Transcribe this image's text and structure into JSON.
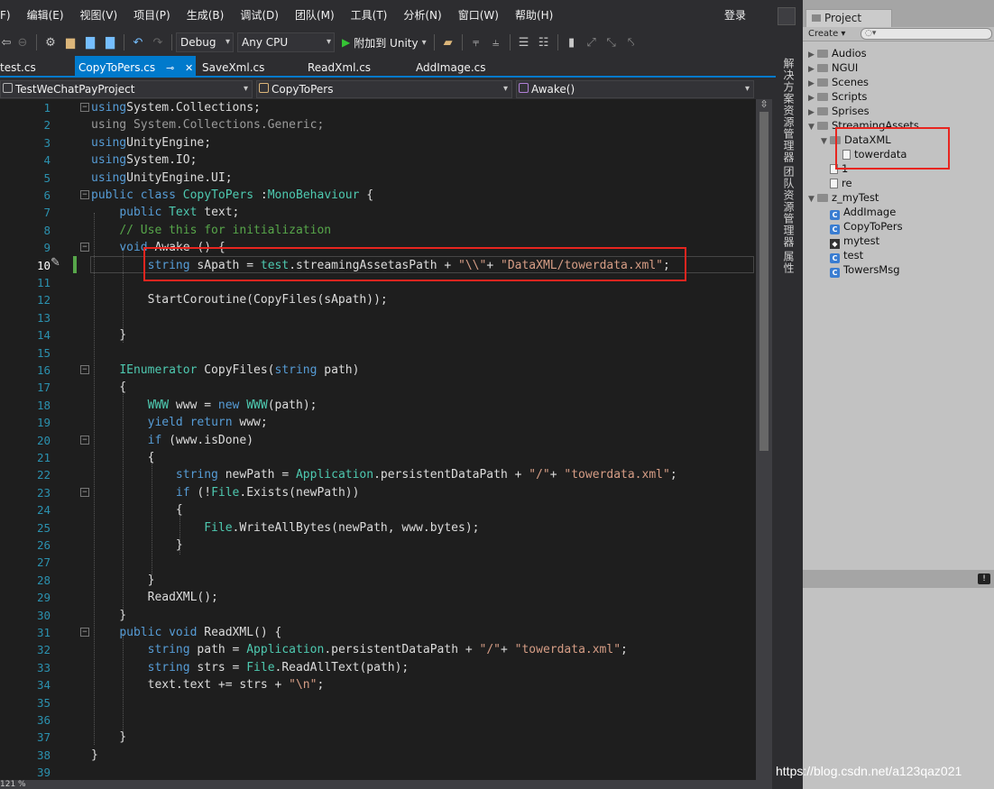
{
  "menu": [
    "F)",
    "编辑(E)",
    "视图(V)",
    "项目(P)",
    "生成(B)",
    "调试(D)",
    "团队(M)",
    "工具(T)",
    "分析(N)",
    "窗口(W)",
    "帮助(H)"
  ],
  "login": "登录",
  "toolbar": {
    "config": "Debug",
    "platform": "Any CPU",
    "attach": "附加到 Unity"
  },
  "tabs": [
    {
      "label": "test.cs"
    },
    {
      "label": "CopyToPers.cs",
      "pin": "⊸",
      "close": "✕"
    },
    {
      "label": "SaveXml.cs"
    },
    {
      "label": "ReadXml.cs"
    },
    {
      "label": "AddImage.cs"
    }
  ],
  "nav": {
    "project": "TestWeChatPayProject",
    "class": "CopyToPers",
    "member": "Awake()"
  },
  "line_numbers": [
    "1",
    "2",
    "3",
    "4",
    "5",
    "6",
    "7",
    "8",
    "9",
    "10",
    "11",
    "12",
    "13",
    "14",
    "15",
    "16",
    "17",
    "18",
    "19",
    "20",
    "21",
    "22",
    "23",
    "24",
    "25",
    "26",
    "27",
    "28",
    "29",
    "30",
    "31",
    "32",
    "33",
    "34",
    "35",
    "36",
    "37",
    "38",
    "39"
  ],
  "code": [
    [
      [
        "kw",
        "using"
      ],
      [
        "",
        "System.Collections;"
      ]
    ],
    [
      [
        "gr",
        "using System.Collections.Generic;"
      ]
    ],
    [
      [
        "kw",
        "using"
      ],
      [
        "",
        "UnityEngine;"
      ]
    ],
    [
      [
        "kw",
        "using"
      ],
      [
        "",
        "System.IO;"
      ]
    ],
    [
      [
        "kw",
        "using"
      ],
      [
        "",
        "UnityEngine.UI;"
      ]
    ],
    [
      [
        "kw",
        "public"
      ],
      [
        "kw",
        "class"
      ],
      [
        "ty",
        "CopyToPers"
      ],
      [
        "",
        " :"
      ],
      [
        "ty",
        "MonoBehaviour"
      ],
      [
        "",
        " {"
      ]
    ],
    [
      [
        "",
        "    "
      ],
      [
        "kw",
        "public"
      ],
      [
        "",
        " "
      ],
      [
        "ty",
        "Text"
      ],
      [
        "",
        " text;"
      ]
    ],
    [
      [
        "",
        "    "
      ],
      [
        "cm",
        "// Use this for initialization"
      ]
    ],
    [
      [
        "",
        "    "
      ],
      [
        "kw",
        "void"
      ],
      [
        "",
        " Awake () {"
      ]
    ],
    [
      [
        "",
        "        "
      ],
      [
        "kw",
        "string"
      ],
      [
        "",
        " sApath = "
      ],
      [
        "ty",
        "test"
      ],
      [
        "",
        ".streamingAssetasPath + "
      ],
      [
        "str",
        "\"\\\\\""
      ],
      [
        "",
        "+ "
      ],
      [
        "str",
        "\"DataXML/towerdata.xml\""
      ],
      [
        "",
        ";"
      ]
    ],
    [],
    [
      [
        "",
        "        StartCoroutine(CopyFiles(sApath));"
      ]
    ],
    [],
    [
      [
        "",
        "    }"
      ]
    ],
    [],
    [
      [
        "",
        "    "
      ],
      [
        "ty",
        "IEnumerator"
      ],
      [
        "",
        " CopyFiles("
      ],
      [
        "kw",
        "string"
      ],
      [
        "",
        " path)"
      ]
    ],
    [
      [
        "",
        "    {"
      ]
    ],
    [
      [
        "",
        "        "
      ],
      [
        "ty",
        "WWW"
      ],
      [
        "",
        " www = "
      ],
      [
        "kw",
        "new"
      ],
      [
        "",
        " "
      ],
      [
        "ty",
        "WWW"
      ],
      [
        "",
        "(path);"
      ]
    ],
    [
      [
        "",
        "        "
      ],
      [
        "kw",
        "yield"
      ],
      [
        "",
        " "
      ],
      [
        "kw",
        "return"
      ],
      [
        "",
        " www;"
      ]
    ],
    [
      [
        "",
        "        "
      ],
      [
        "kw",
        "if"
      ],
      [
        "",
        " (www.isDone)"
      ]
    ],
    [
      [
        "",
        "        {"
      ]
    ],
    [
      [
        "",
        "            "
      ],
      [
        "kw",
        "string"
      ],
      [
        "",
        " newPath = "
      ],
      [
        "ty",
        "Application"
      ],
      [
        "",
        ".persistentDataPath + "
      ],
      [
        "str",
        "\"/\""
      ],
      [
        "",
        "+ "
      ],
      [
        "str",
        "\"towerdata.xml\""
      ],
      [
        "",
        ";"
      ]
    ],
    [
      [
        "",
        "            "
      ],
      [
        "kw",
        "if"
      ],
      [
        "",
        " (!"
      ],
      [
        "ty",
        "File"
      ],
      [
        "",
        ".Exists(newPath))"
      ]
    ],
    [
      [
        "",
        "            {"
      ]
    ],
    [
      [
        "",
        "                "
      ],
      [
        "ty",
        "File"
      ],
      [
        "",
        ".WriteAllBytes(newPath, www.bytes);"
      ]
    ],
    [
      [
        "",
        "            }"
      ]
    ],
    [],
    [
      [
        "",
        "        }"
      ]
    ],
    [
      [
        "",
        "        ReadXML();"
      ]
    ],
    [
      [
        "",
        "    }"
      ]
    ],
    [
      [
        "",
        "    "
      ],
      [
        "kw",
        "public"
      ],
      [
        "",
        " "
      ],
      [
        "kw",
        "void"
      ],
      [
        "",
        " ReadXML() {"
      ]
    ],
    [
      [
        "",
        "        "
      ],
      [
        "kw",
        "string"
      ],
      [
        "",
        " path = "
      ],
      [
        "ty",
        "Application"
      ],
      [
        "",
        ".persistentDataPath + "
      ],
      [
        "str",
        "\"/\""
      ],
      [
        "",
        "+ "
      ],
      [
        "str",
        "\"towerdata.xml\""
      ],
      [
        "",
        ";"
      ]
    ],
    [
      [
        "",
        "        "
      ],
      [
        "kw",
        "string"
      ],
      [
        "",
        " strs = "
      ],
      [
        "ty",
        "File"
      ],
      [
        "",
        ".ReadAllText(path);"
      ]
    ],
    [
      [
        "",
        "        text.text += strs + "
      ],
      [
        "str",
        "\"\\n\""
      ],
      [
        "",
        ";"
      ]
    ],
    [],
    [],
    [
      [
        "",
        "    }"
      ]
    ],
    [
      [
        "",
        "}"
      ]
    ],
    []
  ],
  "side_panels": [
    "解决方案资源管理器",
    "团队资源管理器",
    "属性"
  ],
  "project": {
    "tab": "Project",
    "create": "Create ▾",
    "search_placeholder": "◌▾",
    "items": [
      {
        "label": "Audios",
        "kind": "folder",
        "depth": 0
      },
      {
        "label": "NGUI",
        "kind": "folder",
        "depth": 0
      },
      {
        "label": "Scenes",
        "kind": "folder",
        "depth": 0
      },
      {
        "label": "Scripts",
        "kind": "folder",
        "depth": 0
      },
      {
        "label": "Sprises",
        "kind": "folder",
        "depth": 0
      },
      {
        "label": "StreamingAssets",
        "kind": "folder",
        "depth": 0,
        "open": true
      },
      {
        "label": "DataXML",
        "kind": "folder",
        "depth": 1,
        "open": true
      },
      {
        "label": "towerdata",
        "kind": "file",
        "depth": 2
      },
      {
        "label": "1",
        "kind": "file",
        "depth": 1
      },
      {
        "label": "re",
        "kind": "file",
        "depth": 1
      },
      {
        "label": "z_myTest",
        "kind": "folder",
        "depth": 0,
        "open": true
      },
      {
        "label": "AddImage",
        "kind": "cs",
        "depth": 1
      },
      {
        "label": "CopyToPers",
        "kind": "cs",
        "depth": 1
      },
      {
        "label": "mytest",
        "kind": "unity",
        "depth": 1
      },
      {
        "label": "test",
        "kind": "cs",
        "depth": 1
      },
      {
        "label": "TowersMsg",
        "kind": "cs",
        "depth": 1
      }
    ]
  },
  "zoom": "121 %",
  "watermark": "https://blog.csdn.net/a123qaz021"
}
